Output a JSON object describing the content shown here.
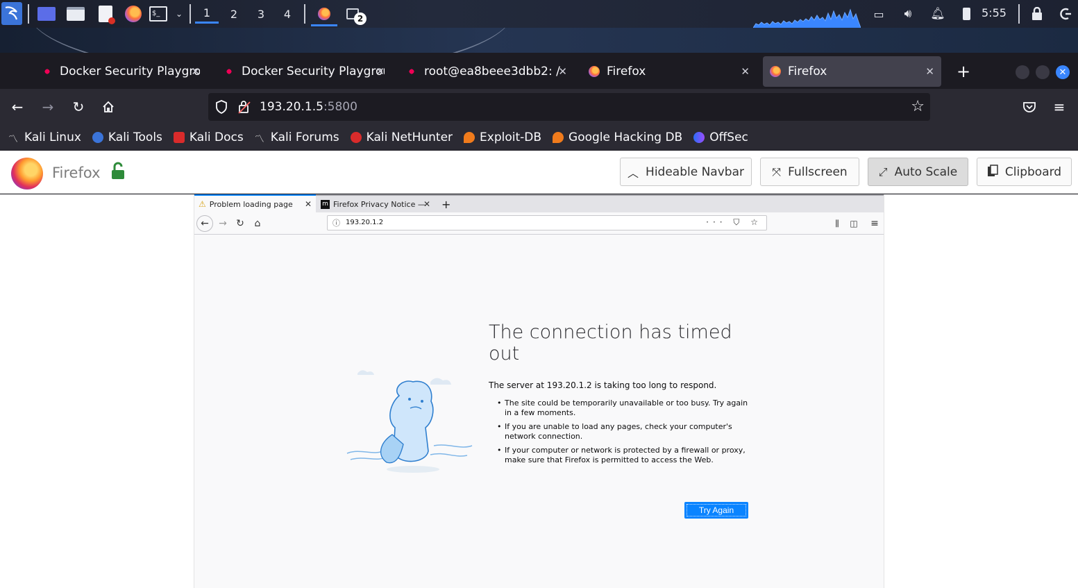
{
  "taskbar": {
    "workspaces": [
      "1",
      "2",
      "3",
      "4"
    ],
    "active_workspace": "1",
    "window_badge": "2",
    "clock": "5:55"
  },
  "browser": {
    "tabs": [
      {
        "label": "Docker Security Playground",
        "icon": "docker-icon",
        "active": false
      },
      {
        "label": "Docker Security Playground",
        "icon": "docker-icon",
        "active": false
      },
      {
        "label": "root@ea8beee3dbb2: /",
        "icon": "terminal-icon",
        "active": false
      },
      {
        "label": "Firefox",
        "icon": "firefox-icon",
        "active": false
      },
      {
        "label": "Firefox",
        "icon": "firefox-icon",
        "active": true
      }
    ],
    "new_tab": "+",
    "url": {
      "host": "193.20.1.5",
      "port": ":5800"
    },
    "bookmarks": [
      {
        "label": "Kali Linux",
        "icon": "kali-dragon-icon"
      },
      {
        "label": "Kali Tools",
        "icon": "kali-tools-icon"
      },
      {
        "label": "Kali Docs",
        "icon": "kali-docs-icon"
      },
      {
        "label": "Kali Forums",
        "icon": "kali-forums-icon"
      },
      {
        "label": "Kali NetHunter",
        "icon": "nethunter-icon"
      },
      {
        "label": "Exploit-DB",
        "icon": "exploitdb-icon"
      },
      {
        "label": "Google Hacking DB",
        "icon": "ghdb-icon"
      },
      {
        "label": "OffSec",
        "icon": "offsec-icon"
      }
    ]
  },
  "vnc": {
    "title": "Firefox",
    "buttons": [
      {
        "label": "Hideable Navbar",
        "icon": "chevron-up-icon",
        "pressed": false
      },
      {
        "label": "Fullscreen",
        "icon": "fullscreen-icon",
        "pressed": false
      },
      {
        "label": "Auto Scale",
        "icon": "resize-icon",
        "pressed": true
      },
      {
        "label": "Clipboard",
        "icon": "clipboard-icon",
        "pressed": false
      }
    ]
  },
  "remote": {
    "tabs": [
      {
        "label": "Problem loading page",
        "icon": "warning-icon",
        "active": true
      },
      {
        "label": "Firefox Privacy Notice —",
        "icon": "mozilla-icon",
        "active": false
      }
    ],
    "new_tab": "+",
    "url": "193.20.1.2",
    "url_actions": "··· ⛉ ☆",
    "error": {
      "title": "The connection has timed out",
      "description": "The server at 193.20.1.2 is taking too long to respond.",
      "bullets": [
        "The site could be temporarily unavailable or too busy. Try again in a few moments.",
        "If you are unable to load any pages, check your computer's network connection.",
        "If your computer or network is protected by a firewall or proxy, make sure that Firefox is permitted to access the Web."
      ],
      "button": "Try Again"
    }
  },
  "colors": {
    "accent": "#0a84ff",
    "browser_chrome": "#2b2a33",
    "tabstrip": "#1c1b22",
    "taskbar_active": "#3a86ff"
  }
}
